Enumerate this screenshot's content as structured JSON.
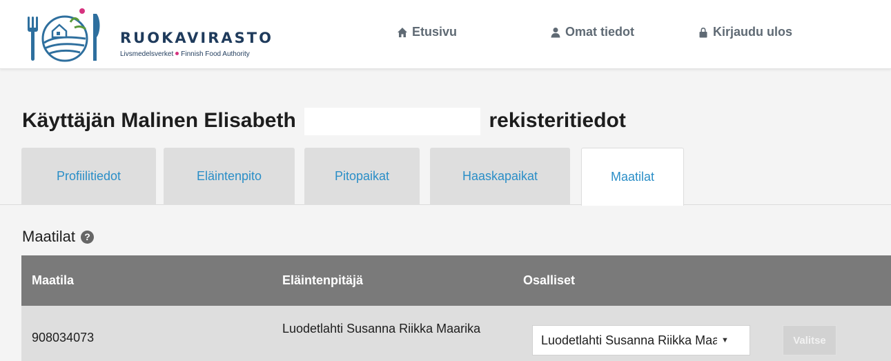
{
  "header": {
    "logo_name": "RUOKAVIRASTO",
    "logo_sub_left": "Livsmedelsverket",
    "logo_sub_right": "Finnish Food Authority",
    "nav": {
      "home_label": "Etusivu",
      "profile_label": "Omat tiedot",
      "logout_label": "Kirjaudu ulos"
    }
  },
  "page": {
    "title_prefix": "Käyttäjän Malinen Elisabeth",
    "title_suffix": "rekisteritiedot"
  },
  "tabs": [
    {
      "label": "Profiilitiedot",
      "active": false
    },
    {
      "label": "Eläintenpito",
      "active": false
    },
    {
      "label": "Pitopaikat",
      "active": false
    },
    {
      "label": "Haaskapaikat",
      "active": false
    },
    {
      "label": "Maatilat",
      "active": true
    }
  ],
  "section": {
    "title": "Maatilat",
    "help_icon": "question-circle-icon"
  },
  "table": {
    "columns": [
      "Maatila",
      "Eläintenpitäjä",
      "Osalliset"
    ],
    "rows": [
      {
        "maatila": "908034073",
        "elaintenpitaja": "Luodetlahti Susanna Riikka Maarika",
        "osalliset_selected": "Luodetlahti Susanna Riikka Maarika",
        "action_label": "Valitse"
      }
    ]
  },
  "colors": {
    "brand_navy": "#1f3b5c",
    "brand_pink": "#d6337f",
    "link_blue": "#2a8ec7",
    "table_header": "#7a7a7a",
    "row_bg": "#dedede"
  }
}
